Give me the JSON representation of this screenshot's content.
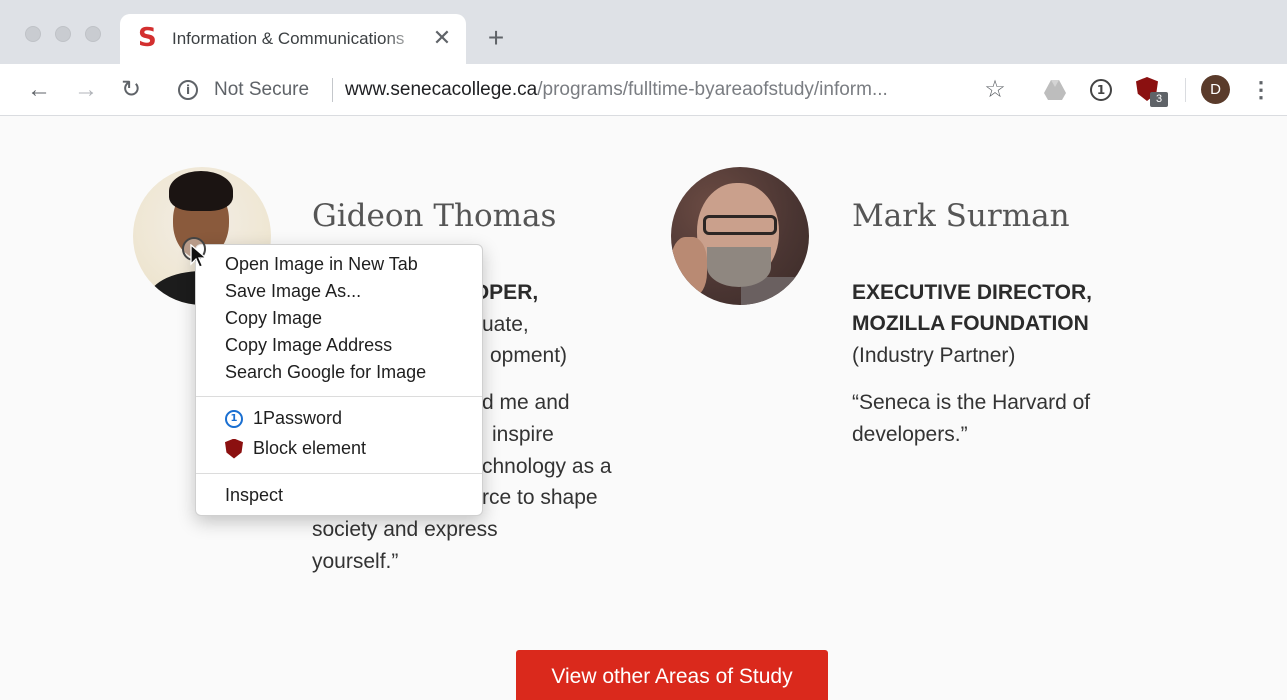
{
  "tab": {
    "title": "Information & Communications",
    "favicon": "S",
    "close": "✕",
    "new_tab": "+"
  },
  "toolbar": {
    "back": "←",
    "forward": "→",
    "reload": "↻",
    "security_icon": "i",
    "security_text": "Not Secure",
    "url_host": "www.senecacollege.ca",
    "url_path": "/programs/fulltime-byareaofstudy/inform...",
    "bookmark": "☆",
    "onepassword_icon": "1",
    "ublock_badge": "3",
    "profile_initial": "D",
    "menu": "⋮"
  },
  "people": {
    "gideon": {
      "name": "Gideon Thomas",
      "role": "VELOPER,",
      "sub_lines": [
        "uate,",
        "opment)"
      ],
      "quote_lines": [
        "d me and",
        "inspire",
        "chnology as a",
        "rce to shape",
        "society and express",
        "yourself.”"
      ]
    },
    "mark": {
      "name": "Mark Surman",
      "role_lines": [
        "EXECUTIVE DIRECTOR,",
        "MOZILLA FOUNDATION"
      ],
      "sub": "(Industry Partner)",
      "quote_lines": [
        "“Seneca is the Harvard of",
        "developers.”"
      ]
    }
  },
  "cta": {
    "label": "View other Areas of Study"
  },
  "context_menu": {
    "items": [
      "Open Image in New Tab",
      "Save Image As...",
      "Copy Image",
      "Copy Image Address",
      "Search Google for Image"
    ],
    "extensions": [
      "1Password",
      "Block element"
    ],
    "inspect": "Inspect"
  },
  "colors": {
    "accent_red": "#da291c",
    "favicon_red": "#d32f2f",
    "ublock_red": "#8b1010",
    "onepassword_blue": "#1a6fd1"
  }
}
